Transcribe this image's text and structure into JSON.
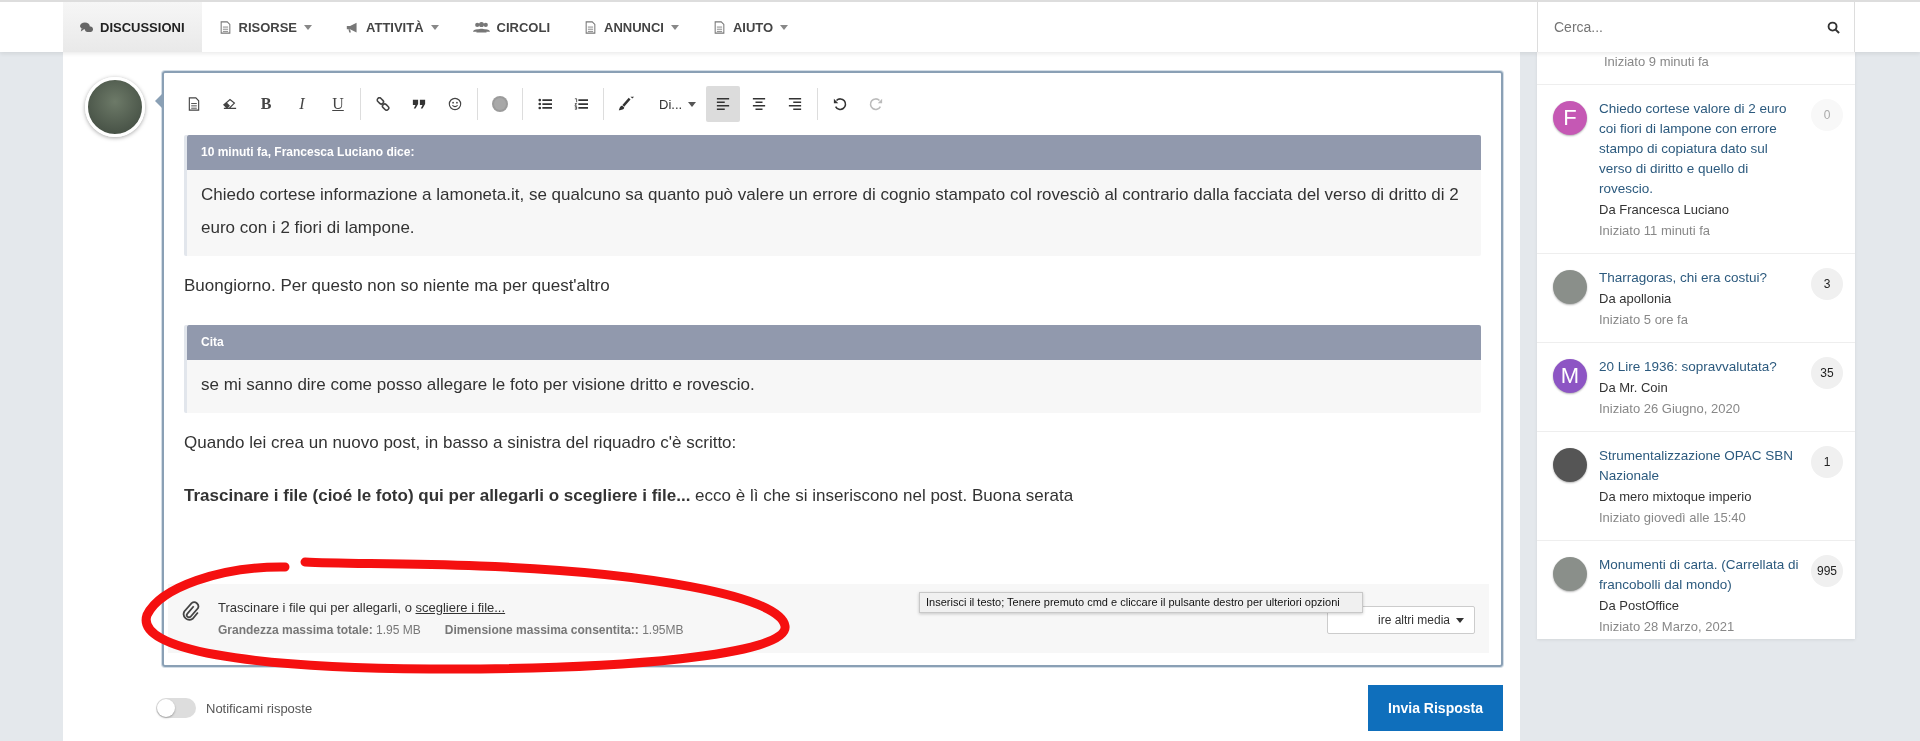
{
  "nav": {
    "items": [
      {
        "label": "DISCUSSIONI",
        "dropdown": false,
        "selected": true
      },
      {
        "label": "RISORSE",
        "dropdown": true,
        "selected": false
      },
      {
        "label": "ATTIVITÀ",
        "dropdown": true,
        "selected": false
      },
      {
        "label": "CIRCOLI",
        "dropdown": false,
        "selected": false
      },
      {
        "label": "ANNUNCI",
        "dropdown": true,
        "selected": false
      },
      {
        "label": "AIUTO",
        "dropdown": true,
        "selected": false
      }
    ]
  },
  "search": {
    "placeholder": "Cerca..."
  },
  "toolbar": {
    "format_letters": [
      "B",
      "I",
      "U"
    ],
    "font_label": "Di...",
    "alignment": [
      {
        "selected": true
      },
      {
        "selected": false
      },
      {
        "selected": false
      }
    ],
    "undo_disabled": false,
    "redo_disabled": true
  },
  "content": [
    {
      "kind": "quote",
      "header": "10 minuti fa, Francesca Luciano dice:",
      "body": "Chiedo cortese informazione a lamoneta.it, se qualcuno sa quanto può valere un errore di cognio stampato col rovesciò al contrario dalla facciata del verso di dritto di 2 euro con i 2 fiori di lampone."
    },
    {
      "kind": "paragraph",
      "text": "Buongiorno. Per questo non so niente ma per quest'altro"
    },
    {
      "kind": "quote",
      "header": "Cita",
      "body": "se mi sanno dire come posso allegare le foto per visione dritto e rovescio."
    },
    {
      "kind": "paragraph",
      "text": "Quando lei crea un nuovo post, in basso a sinistra del riquadro c'è scritto:"
    },
    {
      "kind": "paragraph",
      "text": "**Trascinare i file (cioé le foto) qui per allegarli o scegliere i file...**  ecco è lì che si inseriscono nel post. Buona serata"
    }
  ],
  "attachments": {
    "instruction": "Trascinare i file qui per allegarli, o ",
    "link": "scegliere i file...",
    "limits": [
      "**Grandezza massima totale:** 1.95 MB",
      "**Dimensione massima consentita::** 1.95MB"
    ],
    "media_button": "ire altri media",
    "tooltip": "Inserisci il testo; Tenere premuto cmd e cliccare il pulsante destro per ulteriori opzioni"
  },
  "notify": {
    "label": "Notificami risposte",
    "on": false
  },
  "submit": "Invia Risposta",
  "sidebar": {
    "partial_date": "Iniziato 9 minuti fa",
    "topics": [
      {
        "avatar": {
          "kind": "letter",
          "letter": "F",
          "color": "#c558b4"
        },
        "title": "Chiedo cortese valore di 2 euro coi fiori di lampone con errore stampo di copiatura dato sul verso di diritto e quello di rovescio.",
        "author": "Da Francesca Luciano",
        "date": "Iniziato 11 minuti fa",
        "count": "0",
        "dimmed": true
      },
      {
        "avatar": {
          "kind": "photo"
        },
        "title": "Tharragoras, chi era costui?",
        "author": "Da apollonia",
        "date": "Iniziato 5 ore fa",
        "count": "3",
        "dimmed": false
      },
      {
        "avatar": {
          "kind": "letter",
          "letter": "M",
          "color": "#8d55c4"
        },
        "title": "20 Lire 1936: sopravvalutata?",
        "author": "Da Mr. Coin",
        "date": "Iniziato 26 Giugno, 2020",
        "count": "35",
        "dimmed": false
      },
      {
        "avatar": {
          "kind": "photo"
        },
        "title": "Strumentalizzazione OPAC SBN Nazionale",
        "author": "Da mero mixtoque imperio",
        "date": "Iniziato giovedì alle 15:40",
        "count": "1",
        "dimmed": false
      },
      {
        "avatar": {
          "kind": "photo"
        },
        "title": "Monumenti di carta. (Carrellata di francobolli dal mondo)",
        "author": "Da PostOffice",
        "date": "Iniziato 28 Marzo, 2021",
        "count": "995",
        "dimmed": false
      }
    ]
  }
}
